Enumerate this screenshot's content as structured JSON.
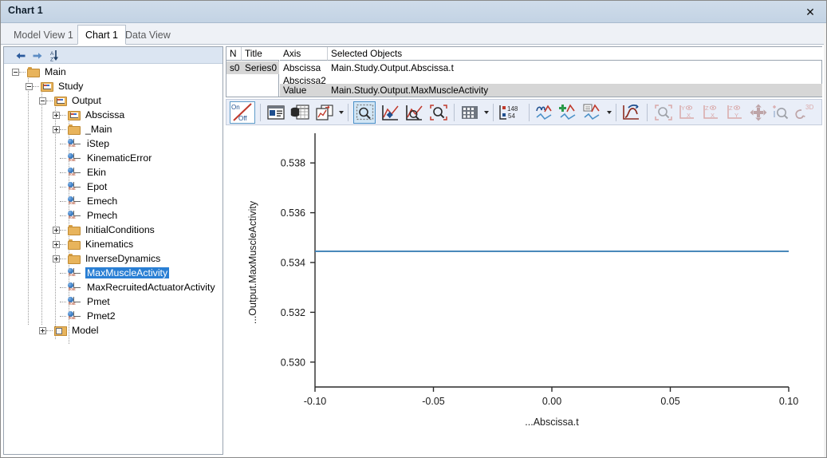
{
  "window": {
    "title": "Chart 1",
    "close_label": "✕"
  },
  "tabs": [
    {
      "label": "Model View 1",
      "active": false
    },
    {
      "label": "Chart 1",
      "active": true
    },
    {
      "label": "Data View",
      "active": false
    }
  ],
  "tree_toolbar": {
    "back_icon": "back-arrow-icon",
    "forward_icon": "forward-arrow-icon",
    "sort_icon": "sort-az-icon",
    "sort_top_label": "A",
    "sort_bottom_label": "Z"
  },
  "tree": {
    "items": [
      {
        "label": "Main",
        "depth": 0,
        "icon": "folder",
        "expander": "minus",
        "selected": false
      },
      {
        "label": "Study",
        "depth": 1,
        "icon": "chartfolder",
        "expander": "minus",
        "selected": false
      },
      {
        "label": "Output",
        "depth": 2,
        "icon": "chartfolder",
        "expander": "minus",
        "selected": false
      },
      {
        "label": "Abscissa",
        "depth": 3,
        "icon": "chartfolder",
        "expander": "plus",
        "selected": false
      },
      {
        "label": "_Main",
        "depth": 3,
        "icon": "folder",
        "expander": "plus",
        "selected": false
      },
      {
        "label": "iStep",
        "depth": 3,
        "icon": "floatvar",
        "expander": "none",
        "selected": false
      },
      {
        "label": "KinematicError",
        "depth": 3,
        "icon": "floatvar",
        "expander": "none",
        "selected": false
      },
      {
        "label": "Ekin",
        "depth": 3,
        "icon": "floatvar",
        "expander": "none",
        "selected": false
      },
      {
        "label": "Epot",
        "depth": 3,
        "icon": "floatvar",
        "expander": "none",
        "selected": false
      },
      {
        "label": "Emech",
        "depth": 3,
        "icon": "floatvar",
        "expander": "none",
        "selected": false
      },
      {
        "label": "Pmech",
        "depth": 3,
        "icon": "floatvar",
        "expander": "none",
        "selected": false
      },
      {
        "label": "InitialConditions",
        "depth": 3,
        "icon": "folder",
        "expander": "plus",
        "selected": false
      },
      {
        "label": "Kinematics",
        "depth": 3,
        "icon": "folder",
        "expander": "plus",
        "selected": false
      },
      {
        "label": "InverseDynamics",
        "depth": 3,
        "icon": "folder",
        "expander": "plus",
        "selected": false
      },
      {
        "label": "MaxMuscleActivity",
        "depth": 3,
        "icon": "floatvar",
        "expander": "none",
        "selected": true
      },
      {
        "label": "MaxRecruitedActuatorActivity",
        "depth": 3,
        "icon": "floatvar",
        "expander": "none",
        "selected": false
      },
      {
        "label": "Pmet",
        "depth": 3,
        "icon": "floatvar",
        "expander": "none",
        "selected": false
      },
      {
        "label": "Pmet2",
        "depth": 3,
        "icon": "floatvar",
        "expander": "none",
        "selected": false
      },
      {
        "label": "Model",
        "depth": 2,
        "icon": "modelic",
        "expander": "plus",
        "selected": false
      }
    ]
  },
  "series_grid": {
    "left_headers": [
      "N",
      "Title"
    ],
    "left_rows": [
      [
        "s0",
        "Series0"
      ]
    ],
    "right_headers": [
      "Axis",
      "Selected Objects"
    ],
    "right_rows": [
      {
        "axis": "Abscissa",
        "object": "Main.Study.Output.Abscissa.t",
        "highlight": false
      },
      {
        "axis": "Abscissa2",
        "object": "",
        "highlight": false
      },
      {
        "axis": "Value",
        "object": "Main.Study.Output.MaxMuscleActivity",
        "highlight": true
      }
    ]
  },
  "toolbar": {
    "on_label": "On",
    "off_label": "Off",
    "counter_top": "148",
    "counter_bottom": "54",
    "three_d_label": "3D",
    "buttons": [
      {
        "name": "on-off-toggle-button",
        "enabled": true,
        "selected": false
      },
      {
        "name": "properties-panel-button",
        "enabled": true,
        "selected": false
      },
      {
        "name": "data-table-button",
        "enabled": true,
        "selected": false
      },
      {
        "name": "new-chart-button",
        "enabled": true,
        "selected": false
      },
      {
        "name": "new-chart-dropdown",
        "enabled": true,
        "selected": false
      },
      {
        "name": "zoom-box-button",
        "enabled": true,
        "selected": true
      },
      {
        "name": "pan-chart-button",
        "enabled": true,
        "selected": false
      },
      {
        "name": "zoom-chart-button",
        "enabled": true,
        "selected": false
      },
      {
        "name": "zoom-fit-button",
        "enabled": true,
        "selected": false
      },
      {
        "name": "grid-toggle-button",
        "enabled": true,
        "selected": false
      },
      {
        "name": "grid-dropdown",
        "enabled": true,
        "selected": false
      },
      {
        "name": "frame-counter-button",
        "enabled": true,
        "selected": false
      },
      {
        "name": "curve-style-button",
        "enabled": true,
        "selected": false
      },
      {
        "name": "add-curve-button",
        "enabled": true,
        "selected": false
      },
      {
        "name": "curve-legend-button",
        "enabled": true,
        "selected": false
      },
      {
        "name": "curve-dropdown",
        "enabled": true,
        "selected": false
      },
      {
        "name": "redo-curve-button",
        "enabled": true,
        "selected": false
      },
      {
        "name": "zoom-window-button",
        "enabled": false,
        "selected": false
      },
      {
        "name": "view-yx-button",
        "enabled": false,
        "selected": false
      },
      {
        "name": "view-zx-button",
        "enabled": false,
        "selected": false
      },
      {
        "name": "view-zy-button",
        "enabled": false,
        "selected": false
      },
      {
        "name": "pan-3d-button",
        "enabled": false,
        "selected": false
      },
      {
        "name": "zoom-3d-button",
        "enabled": false,
        "selected": false
      },
      {
        "name": "rotate-3d-button",
        "enabled": false,
        "selected": false
      }
    ]
  },
  "chart_data": {
    "type": "line",
    "title": "",
    "xlabel": "...Abscissa.t",
    "ylabel": "...Output.MaxMuscleActivity",
    "xlim": [
      -0.1,
      0.1
    ],
    "ylim": [
      0.529,
      0.539
    ],
    "xticks": [
      -0.1,
      -0.05,
      0.0,
      0.05,
      0.1
    ],
    "xticklabels": [
      "-0.10",
      "-0.05",
      "0.00",
      "0.05",
      "0.10"
    ],
    "yticks": [
      0.53,
      0.532,
      0.534,
      0.536,
      0.538
    ],
    "yticklabels": [
      "0.530",
      "0.532",
      "0.534",
      "0.536",
      "0.538"
    ],
    "grid": false,
    "legend": false,
    "line_color": "#3b7fb5",
    "series": [
      {
        "name": "Series0",
        "x": [
          -0.1,
          -0.05,
          0.0,
          0.05,
          0.1
        ],
        "values": [
          0.53445,
          0.53445,
          0.53445,
          0.53445,
          0.53445
        ]
      }
    ]
  }
}
